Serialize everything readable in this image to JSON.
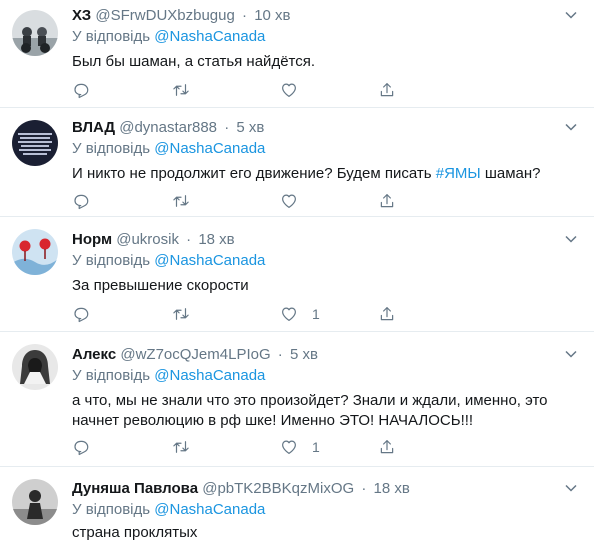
{
  "reply_prefix": "У відповідь",
  "tweets": [
    {
      "name": "ХЗ",
      "handle": "@SFrwDUXbzbugug",
      "time": "10 хв",
      "reply_to": "@NashaCanada",
      "text": "Был бы шаман, а статья найдётся.",
      "like_count": ""
    },
    {
      "name": "ВЛАД",
      "handle": "@dynastar888",
      "time": "5 хв",
      "reply_to": "@NashaCanada",
      "text_before": "И никто не продолжит его движение? Будем писать ",
      "hashtag": "#ЯМЫ",
      "text_after": " шаман?",
      "like_count": ""
    },
    {
      "name": "Норм",
      "handle": "@ukrosik",
      "time": "18 хв",
      "reply_to": "@NashaCanada",
      "text": "За превышение скорости",
      "like_count": "1"
    },
    {
      "name": "Алекс",
      "handle": "@wZ7ocQJem4LPIoG",
      "time": "5 хв",
      "reply_to": "@NashaCanada",
      "text_line1": "а что, мы не знали что это произойдет? Знали и ждали, именно, это",
      "text_line2": "начнет революцию в рф шке! Именно ЭТО! НАЧАЛОСЬ!!!",
      "like_count": "1"
    },
    {
      "name": "Дуняша Павлова",
      "handle": "@pbTK2BBKqzMixOG",
      "time": "18 хв",
      "reply_to": "@NashaCanada",
      "text": "страна проклятых"
    }
  ]
}
